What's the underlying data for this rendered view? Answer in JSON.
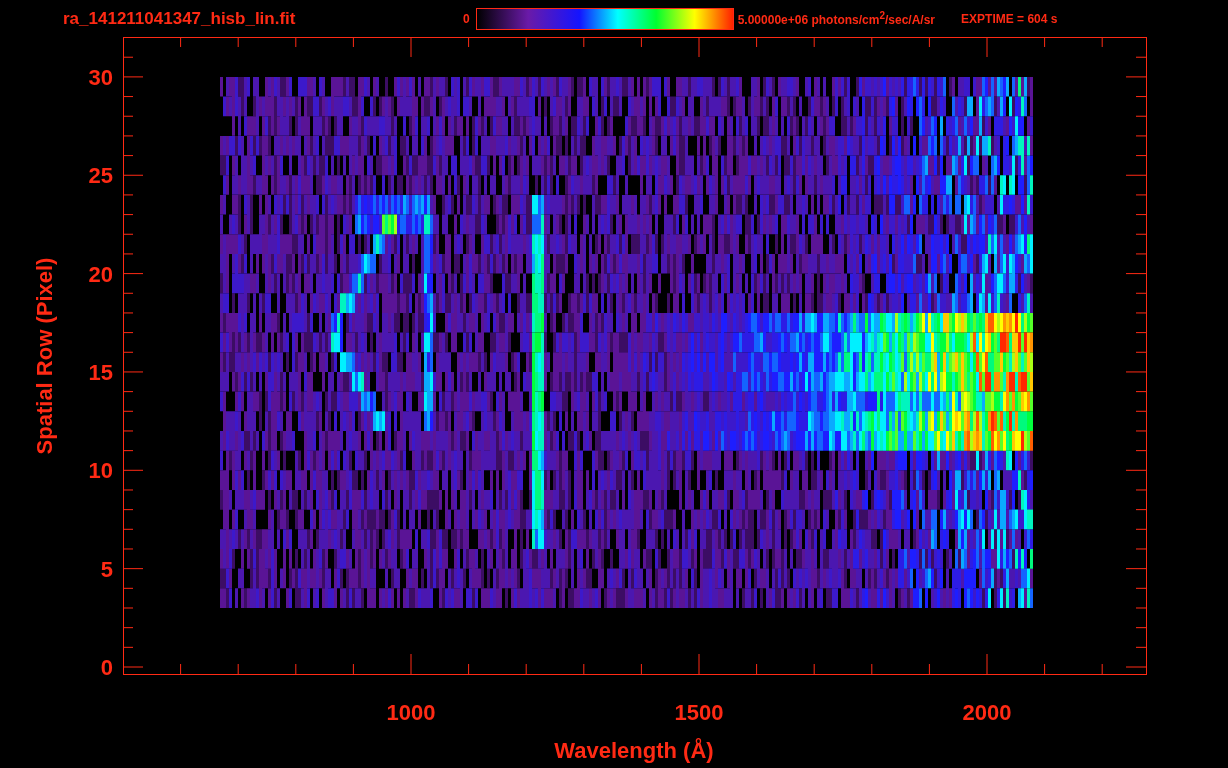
{
  "header": {
    "title": "ra_141211041347_hisb_lin.fit",
    "colorbar_min": "0",
    "colorbar_max": "5.00000e+06 photons/cm$^{2}$/sec/A/sr",
    "exptime": "EXPTIME = 604 s"
  },
  "plot": {
    "xlabel": "Wavelength (Å)",
    "ylabel": "Spatial Row (Pixel)",
    "xtick_labels": [
      "1000",
      "1500",
      "2000"
    ],
    "ytick_labels": [
      "30",
      "25",
      "20",
      "15",
      "10",
      "5",
      "0"
    ]
  }
}
